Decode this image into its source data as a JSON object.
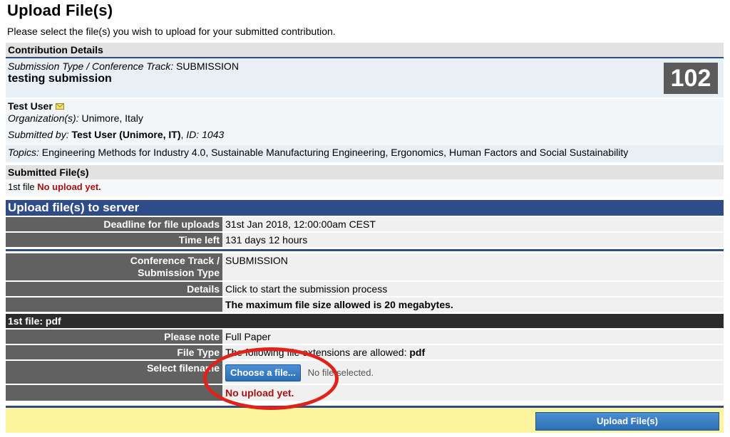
{
  "page": {
    "title": "Upload File(s)",
    "intro": "Please select the file(s) you wish to upload for your submitted contribution."
  },
  "contribution": {
    "header": "Contribution Details",
    "type_label": "Submission Type / Conference Track:",
    "type_value": "SUBMISSION",
    "submission_title": "testing submission",
    "number": "102",
    "author_name": "Test User",
    "org_label": "Organization(s):",
    "org_value": "Unimore, Italy",
    "submitted_by_label": "Submitted by:",
    "submitted_by_value": "Test User (Unimore, IT)",
    "id_label": "ID:",
    "id_value": "1043",
    "topics_label": "Topics:",
    "topics_value": "Engineering Methods for Industry 4.0, Sustainable Manufacturing Engineering, Ergonomics, Human Factors and Social Sustainability"
  },
  "submitted_files": {
    "header": "Submitted File(s)",
    "file_label": "1st file",
    "file_status": "No upload yet."
  },
  "upload": {
    "header": "Upload file(s) to server",
    "deadline_label": "Deadline for file uploads",
    "deadline_value": "31st Jan 2018, 12:00:00am CEST",
    "time_left_label": "Time left",
    "time_left_value": "131 days 12 hours",
    "track_label_1": "Conference Track /",
    "track_label_2": "Submission Type",
    "track_value": "SUBMISSION",
    "details_label": "Details",
    "details_value": "Click to start the submission process",
    "max_size": "The maximum file size allowed is 20 megabytes.",
    "file_header": "1st file: pdf",
    "note_label": "Please note",
    "note_value": "Full Paper",
    "type_label": "File Type",
    "type_value_prefix": "The following file extensions are allowed:",
    "type_value_ext": "pdf",
    "select_label": "Select filename",
    "choose_button": "Choose a file...",
    "no_file": "No file selected.",
    "status": "No upload yet.",
    "submit_button": "Upload File(s)"
  },
  "colors": {
    "accent_blue": "#2e4b8a",
    "label_gray": "#616161",
    "error_red": "#aa1111",
    "footer_yellow": "#fdf49e",
    "annotation_red": "#e0221b"
  }
}
